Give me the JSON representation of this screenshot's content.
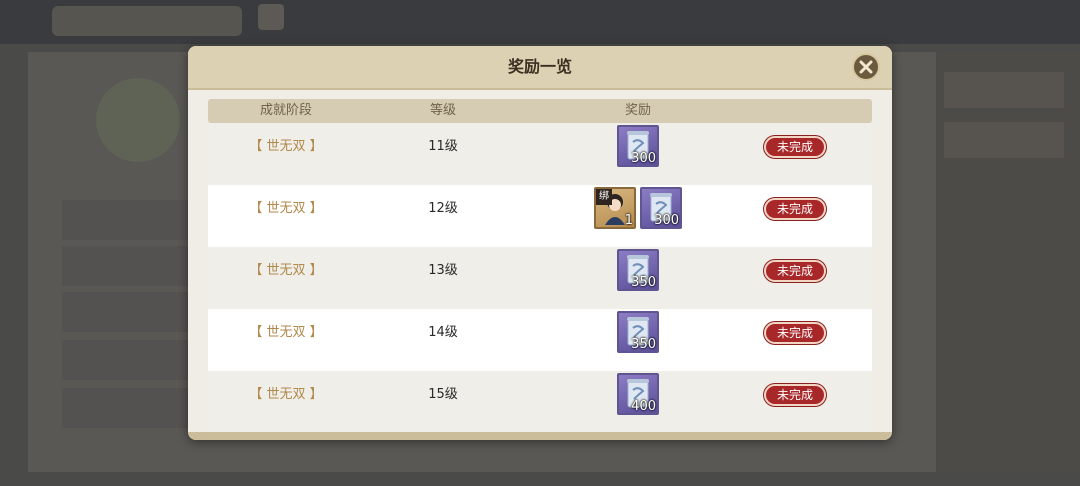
{
  "modal": {
    "title": "奖励一览",
    "close_icon": "close-icon"
  },
  "columns": {
    "stage": "成就阶段",
    "level": "等级",
    "reward": "奖励"
  },
  "rows": [
    {
      "stage": "【 世无双 】",
      "level": "11级",
      "rewards": [
        {
          "icon": "scroll-icon",
          "qty": "300"
        }
      ],
      "status": "未完成"
    },
    {
      "stage": "【 世无双 】",
      "level": "12级",
      "rewards": [
        {
          "icon": "character-icon",
          "qty": "1",
          "bound": "绑"
        },
        {
          "icon": "scroll-icon",
          "qty": "300"
        }
      ],
      "status": "未完成"
    },
    {
      "stage": "【 世无双 】",
      "level": "13级",
      "rewards": [
        {
          "icon": "scroll-icon",
          "qty": "350"
        }
      ],
      "status": "未完成"
    },
    {
      "stage": "【 世无双 】",
      "level": "14级",
      "rewards": [
        {
          "icon": "scroll-icon",
          "qty": "350"
        }
      ],
      "status": "未完成"
    },
    {
      "stage": "【 世无双 】",
      "level": "15级",
      "rewards": [
        {
          "icon": "scroll-icon",
          "qty": "400"
        }
      ],
      "status": "未完成"
    }
  ],
  "colors": {
    "status_badge": "#a8282a",
    "stage_text": "#b0894b",
    "header_bg": "#ddd1b4"
  }
}
